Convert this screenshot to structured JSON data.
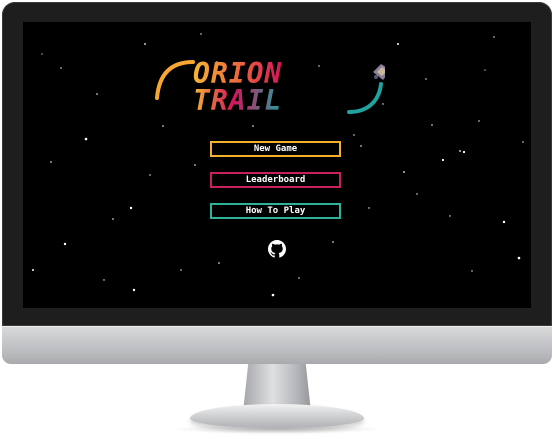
{
  "game": {
    "logo_line1": "ORION",
    "logo_line2": "TRAIL"
  },
  "menu": {
    "new_game": "New Game",
    "leaderboard": "Leaderboard",
    "how_to_play": "How To Play"
  },
  "footer": {
    "github_icon": "github-icon"
  },
  "colors": {
    "new_game_border": "#f2b12b",
    "leaderboard_border": "#c8205e",
    "how_to_play_border": "#2ab598",
    "logo_gradient": [
      "#f7b733",
      "#ef4a3b",
      "#d4145a",
      "#1fa2a0"
    ]
  }
}
